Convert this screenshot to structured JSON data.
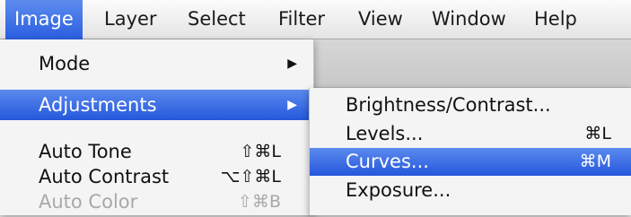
{
  "menubar": {
    "items": [
      {
        "label": "Image",
        "active": true
      },
      {
        "label": "Layer"
      },
      {
        "label": "Select"
      },
      {
        "label": "Filter"
      },
      {
        "label": "View"
      },
      {
        "label": "Window"
      },
      {
        "label": "Help"
      }
    ]
  },
  "image_menu": {
    "items": [
      {
        "label": "Mode",
        "arrow": "▶"
      },
      {
        "label": "Adjustments",
        "arrow": "▶",
        "highlighted": true
      },
      {
        "label": "Auto Tone",
        "shortcut": "⇧⌘L"
      },
      {
        "label": "Auto Contrast",
        "shortcut": "⌥⇧⌘L"
      },
      {
        "label": "Auto Color",
        "shortcut": "⇧⌘B",
        "disabled": true
      }
    ]
  },
  "adjustments_submenu": {
    "items": [
      {
        "label": "Brightness/Contrast..."
      },
      {
        "label": "Levels...",
        "shortcut": "⌘L"
      },
      {
        "label": "Curves...",
        "shortcut": "⌘M",
        "highlighted": true
      },
      {
        "label": "Exposure..."
      }
    ]
  },
  "colors": {
    "highlight": "#2f63e0",
    "menu_bg": "#f4f4f4",
    "disabled_text": "#a8a8a8"
  }
}
